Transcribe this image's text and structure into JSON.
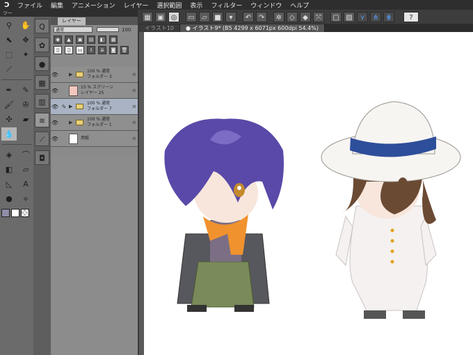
{
  "menubar": {
    "items": [
      "ファイル",
      "編集",
      "アニメーション",
      "レイヤー",
      "選択範囲",
      "表示",
      "フィルター",
      "ウィンドウ",
      "ヘルプ"
    ]
  },
  "toolbar": {
    "help_label": "?"
  },
  "canvas_tabs": [
    {
      "label": "イラスト10"
    },
    {
      "label": "● イラスト9* (B5 4299 x 6071px 600dpi 54.4%)"
    }
  ],
  "tool_panel": {
    "tab_label": "ツー"
  },
  "layer_panel": {
    "tab_label": "レイヤー",
    "blend_mode": "通常",
    "opacity": "100",
    "layers": [
      {
        "opacity_mode": "100 % 通常",
        "name": "フォルダー 3",
        "type": "folder",
        "visible": true,
        "selected": false
      },
      {
        "opacity_mode": "15 % スクリーン",
        "name": "レイヤー 25",
        "type": "raster",
        "visible": true,
        "selected": false,
        "thumb_color": "#f2c7bd"
      },
      {
        "opacity_mode": "100 % 通常",
        "name": "フォルダー 7",
        "type": "folder",
        "visible": true,
        "selected": true
      },
      {
        "opacity_mode": "100 % 通常",
        "name": "フォルダー 1",
        "type": "folder",
        "visible": true,
        "selected": false
      },
      {
        "opacity_mode": "",
        "name": "用紙",
        "type": "paper",
        "visible": true,
        "selected": false
      }
    ]
  },
  "colors": {
    "menubar_bg": "#2e2e2e",
    "panel_bg": "#8a8a8a",
    "selected_layer": "#a9b3c4",
    "canvas_bg": "#ffffff",
    "foreground_swatch": "#8e8ea8",
    "background_swatch": "#ffffff"
  }
}
